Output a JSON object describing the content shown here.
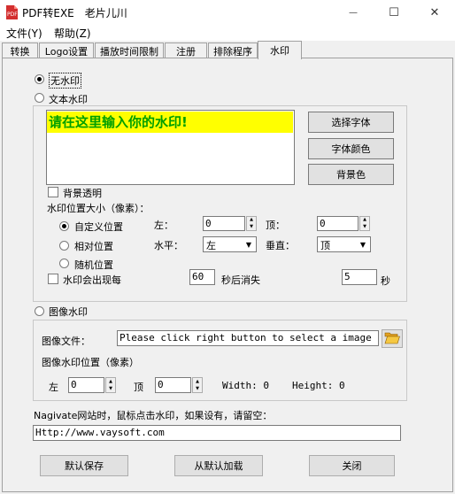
{
  "window": {
    "title": "PDF转EXE　老片儿川",
    "minimize": "—",
    "maximize": "☐",
    "close": "✕"
  },
  "menu": [
    "文件(Y)",
    "帮助(Z)"
  ],
  "tabs": [
    "转换",
    "Logo设置",
    "播放时间限制",
    "注册",
    "排除程序",
    "水印"
  ],
  "active_tab": "水印",
  "no_watermark": {
    "label": "无水印",
    "selected": true
  },
  "text_watermark": {
    "label": "文本水印",
    "text": "请在这里输入你的水印!",
    "text_color": "#00a000",
    "bg_color": "#ffff00",
    "select_font": "选择字体",
    "font_color": "字体颜色",
    "background_color": "背景色",
    "transparent_bg": "背景透明",
    "position_size": "水印位置大小（像素）：",
    "custom_position": "自定义位置",
    "left_label": "左：",
    "left_value": "0",
    "top_label": "顶：",
    "top_value": "0",
    "relative_position": "相对位置",
    "horizontal_label": "水平：",
    "horizontal_value": "左",
    "vertical_label": "垂直：",
    "vertical_value": "顶",
    "random_position": "随机位置",
    "appear_every": "水印会出现每",
    "appear_seconds": "60",
    "disappear_after": "秒后消失",
    "disappear_seconds": "5",
    "seconds_unit": "秒"
  },
  "image_watermark": {
    "label": "图像水印",
    "file_label": "图像文件：",
    "file_placeholder": "Please click right button to select a image file-",
    "position_label": "图像水印位置（像素）",
    "left_label": "左",
    "left_value": "0",
    "top_label": "顶",
    "top_value": "0",
    "width_label": "Width: 0",
    "height_label": "Height: 0"
  },
  "navigate": {
    "label": "Nagivate网站时，鼠标点击水印，如果设有，请留空：",
    "url": "Http://www.vaysoft.com"
  },
  "buttons": {
    "save_default": "默认保存",
    "load_default": "从默认加载",
    "close": "关闭"
  }
}
